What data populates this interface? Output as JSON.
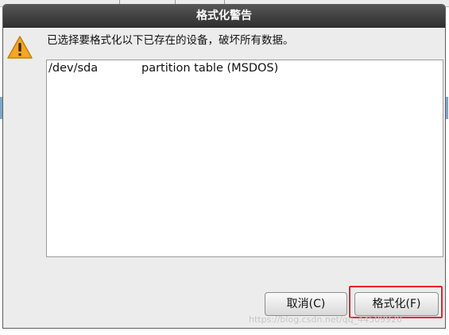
{
  "dialog": {
    "title": "格式化警告",
    "message": "已选择要格式化以下已存在的设备，破坏所有数据。",
    "icon": "warning-icon",
    "devices": [
      {
        "device": "/dev/sda",
        "description": "partition table (MSDOS)"
      }
    ],
    "buttons": {
      "cancel": "取消(C)",
      "format": "格式化(F)"
    }
  },
  "watermark": "https://blog.csdn.net/qq_44509920",
  "colors": {
    "titlebar": "#3d3d3d",
    "dialog_bg": "#ececec",
    "warning": "#f5a623",
    "highlight": "#e8222a"
  }
}
